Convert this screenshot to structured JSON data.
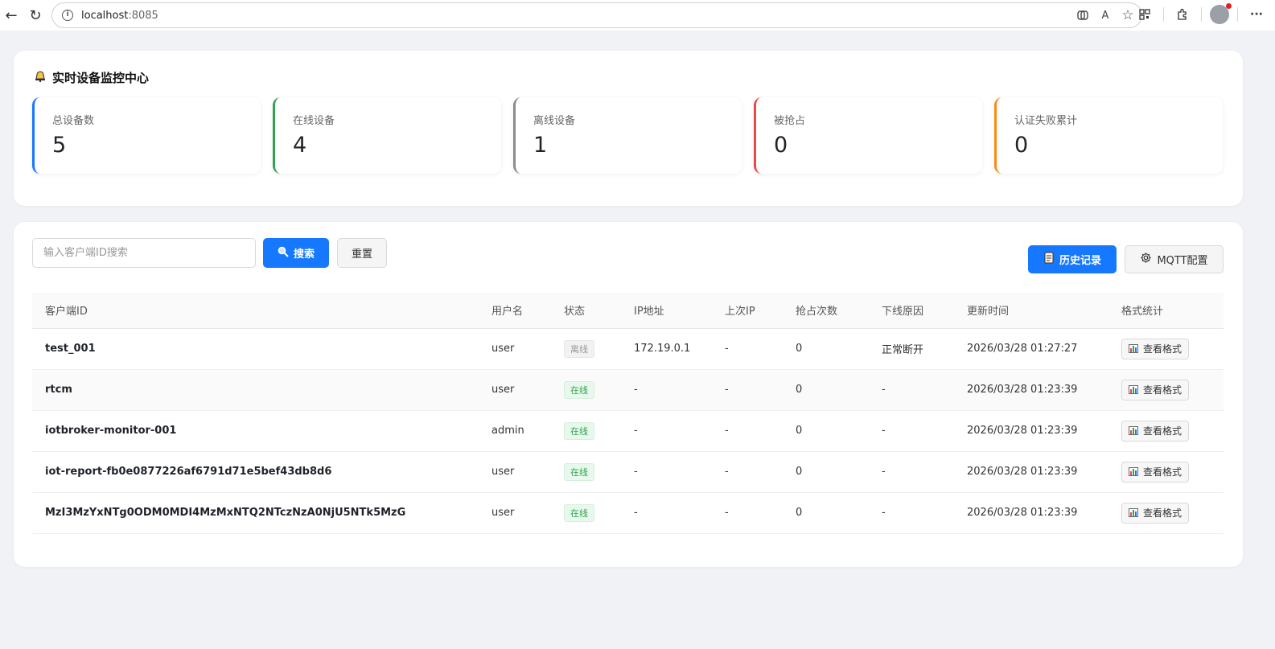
{
  "browser": {
    "url_host": "localhost",
    "url_port": ":8085",
    "info_symbol": "i",
    "back_symbol": "←",
    "reload_symbol": "↻",
    "read_aloud_symbol": "A",
    "favorite_symbol": "☆",
    "more_symbol": "···"
  },
  "stats": {
    "title": "实时设备监控中心",
    "items": [
      {
        "label": "总设备数",
        "value": "5",
        "color": "#1677ff"
      },
      {
        "label": "在线设备",
        "value": "4",
        "color": "#2da44e"
      },
      {
        "label": "离线设备",
        "value": "1",
        "color": "#8c8c8c"
      },
      {
        "label": "被抢占",
        "value": "0",
        "color": "#e5484d"
      },
      {
        "label": "认证失败累计",
        "value": "0",
        "color": "#fa8c16"
      }
    ]
  },
  "toolbar": {
    "search_placeholder": "输入客户端ID搜索",
    "search_label": "搜索",
    "reset_label": "重置",
    "history_label": "历史记录",
    "mqtt_label": "MQTT配置"
  },
  "table": {
    "headers": [
      "客户端ID",
      "用户名",
      "状态",
      "IP地址",
      "上次IP",
      "抢占次数",
      "下线原因",
      "更新时间",
      "格式统计"
    ],
    "rows": [
      {
        "client_id": "test_001",
        "username": "user",
        "status": "离线",
        "status_type": "offline",
        "ip": "172.19.0.1",
        "last_ip": "-",
        "preempt": "0",
        "reason": "正常断开",
        "updated": "2026/03/28 01:27:27",
        "action": "查看格式"
      },
      {
        "client_id": "rtcm",
        "username": "user",
        "status": "在线",
        "status_type": "online",
        "ip": "-",
        "last_ip": "-",
        "preempt": "0",
        "reason": "-",
        "updated": "2026/03/28 01:23:39",
        "action": "查看格式"
      },
      {
        "client_id": "iotbroker-monitor-001",
        "username": "admin",
        "status": "在线",
        "status_type": "online",
        "ip": "-",
        "last_ip": "-",
        "preempt": "0",
        "reason": "-",
        "updated": "2026/03/28 01:23:39",
        "action": "查看格式"
      },
      {
        "client_id": "iot-report-fb0e0877226af6791d71e5bef43db8d6",
        "username": "user",
        "status": "在线",
        "status_type": "online",
        "ip": "-",
        "last_ip": "-",
        "preempt": "0",
        "reason": "-",
        "updated": "2026/03/28 01:23:39",
        "action": "查看格式"
      },
      {
        "client_id": "MzI3MzYxNTg0ODM0MDI4MzMxNTQ2NTczNzA0NjU5NTk5MzG",
        "username": "user",
        "status": "在线",
        "status_type": "online",
        "ip": "-",
        "last_ip": "-",
        "preempt": "0",
        "reason": "-",
        "updated": "2026/03/28 01:23:39",
        "action": "查看格式"
      }
    ]
  }
}
